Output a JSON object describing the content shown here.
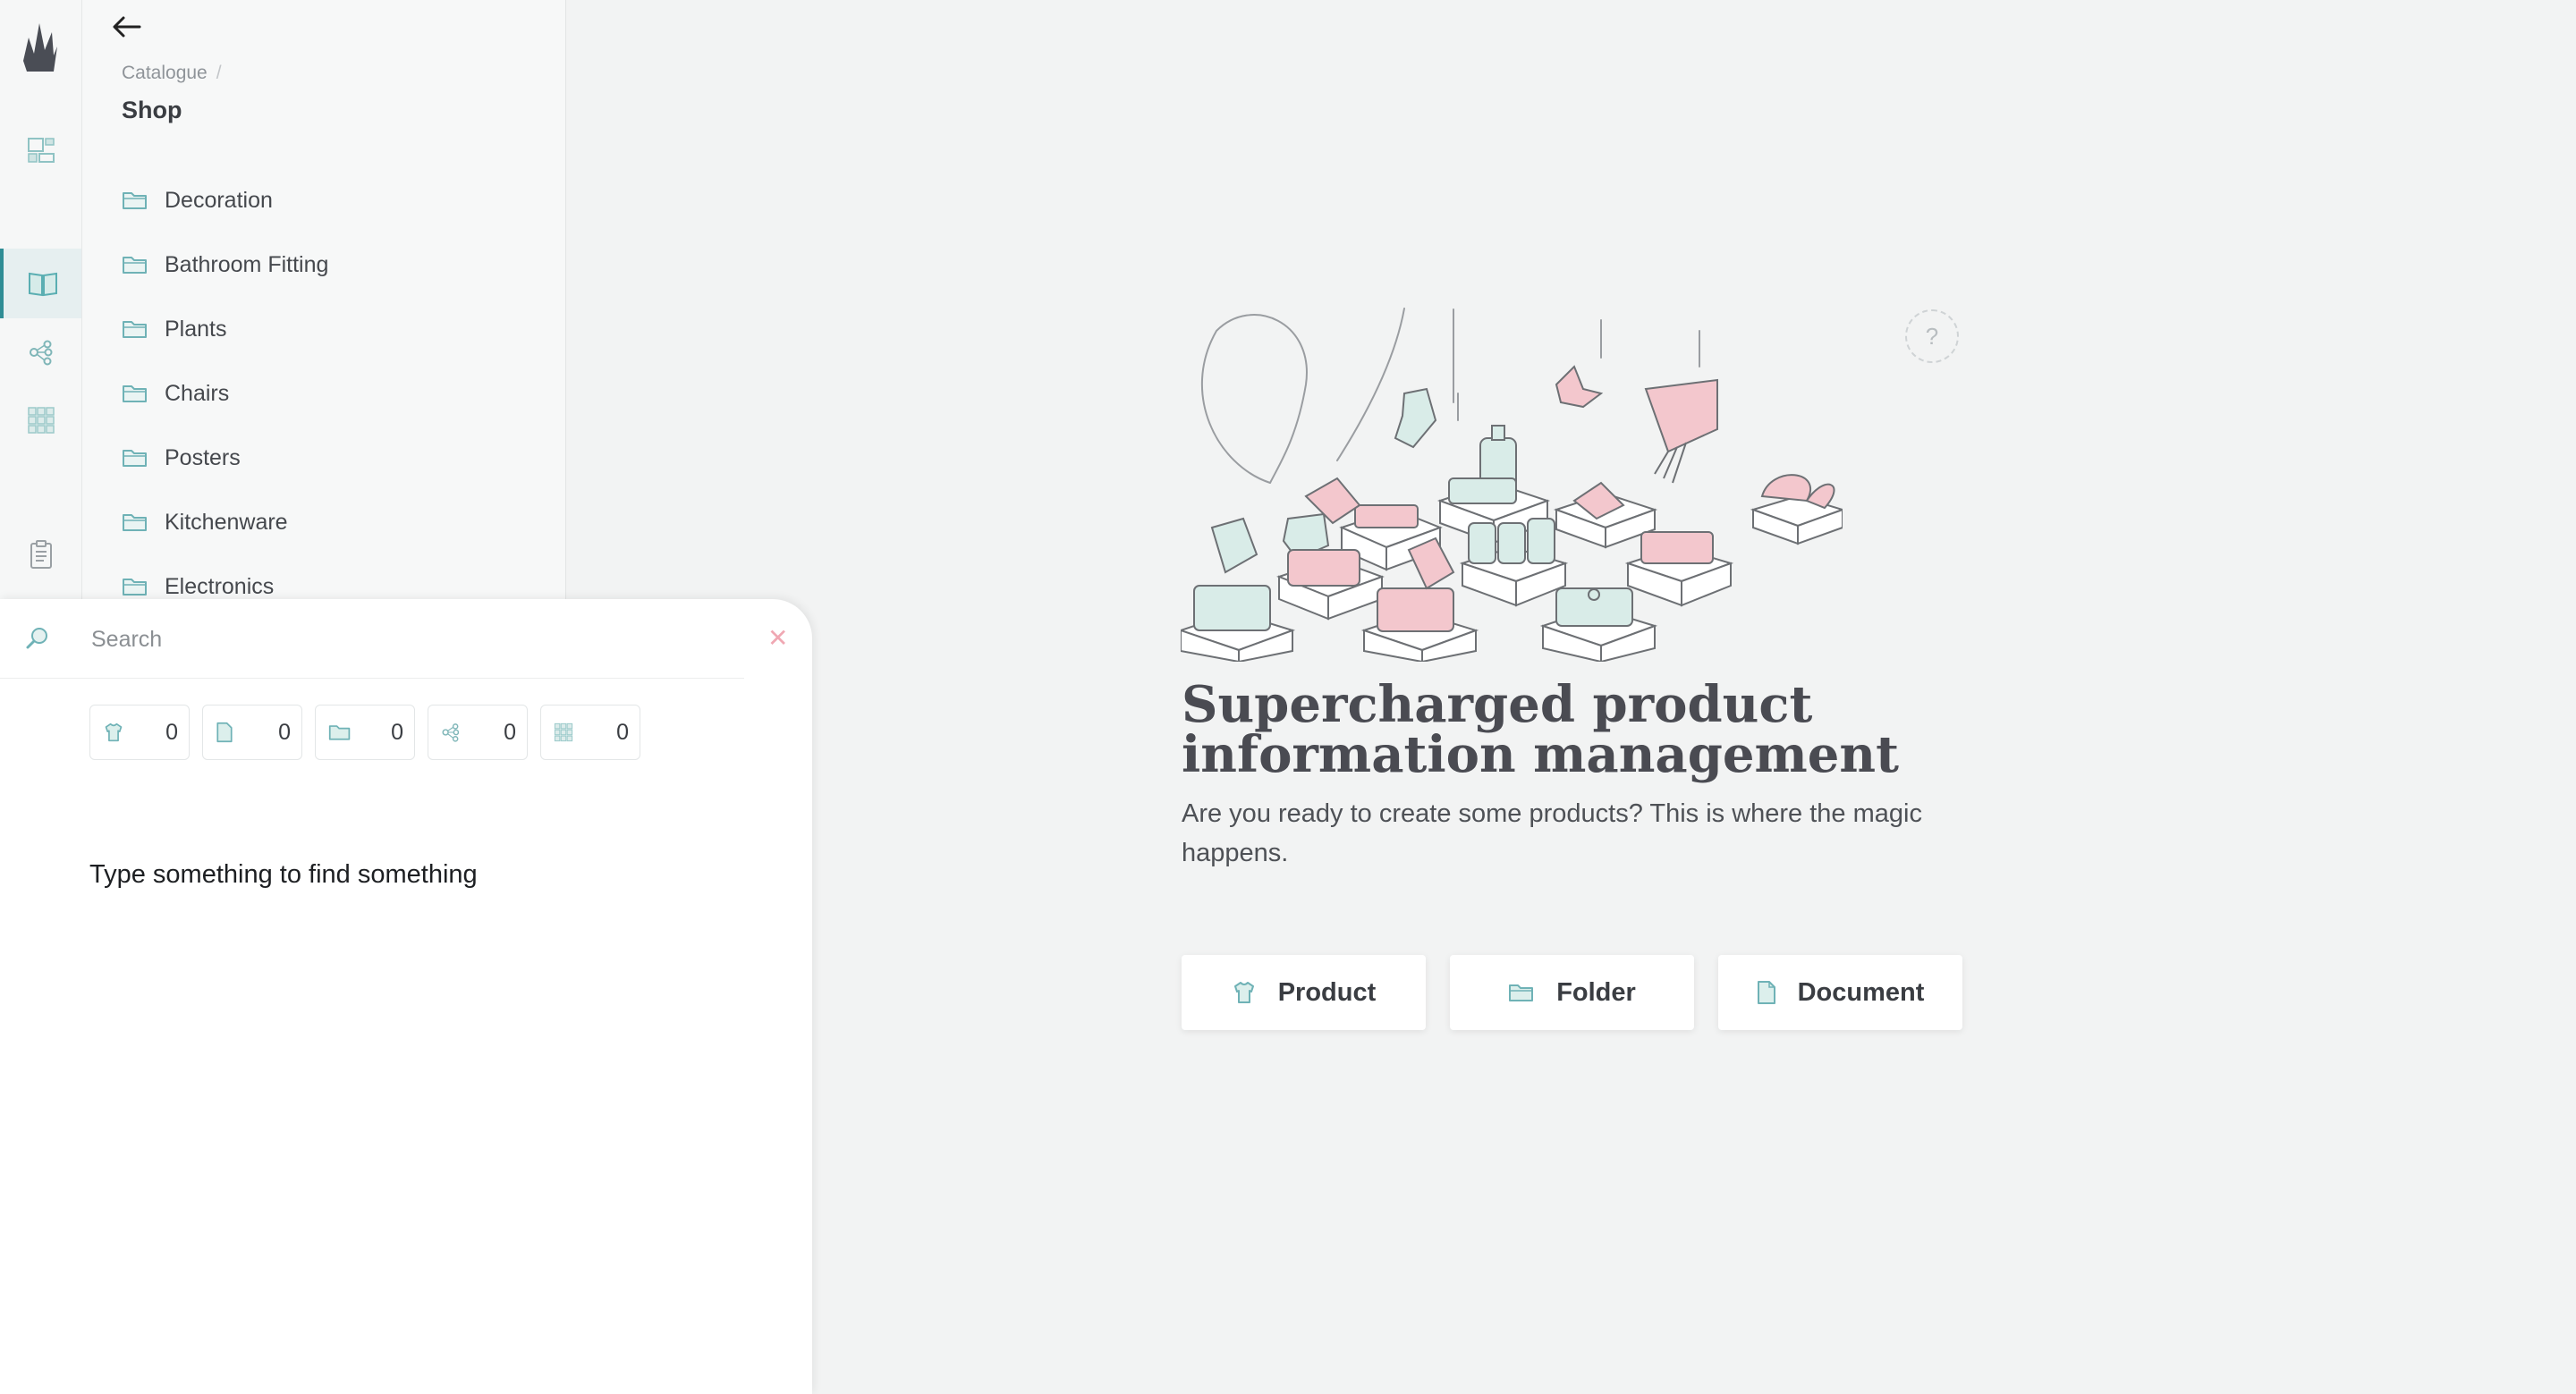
{
  "rail": {
    "items": [
      {
        "icon": "dashboard-icon"
      },
      {
        "icon": "catalogue-book-icon",
        "active": true
      },
      {
        "icon": "relations-graph-icon"
      },
      {
        "icon": "grid-icon"
      },
      {
        "icon": "clipboard-icon"
      }
    ]
  },
  "tree": {
    "breadcrumb": "Catalogue",
    "breadcrumb_separator": "/",
    "title": "Shop",
    "folders": [
      "Decoration",
      "Bathroom Fitting",
      "Plants",
      "Chairs",
      "Posters",
      "Kitchenware",
      "Electronics"
    ]
  },
  "search": {
    "placeholder": "Search",
    "value": "",
    "close_icon": "close-icon",
    "counters": [
      {
        "icon": "product-icon",
        "count": "0"
      },
      {
        "icon": "document-icon",
        "count": "0"
      },
      {
        "icon": "folder-icon",
        "count": "0"
      },
      {
        "icon": "relations-icon",
        "count": "0"
      },
      {
        "icon": "grid-icon",
        "count": "0"
      }
    ],
    "empty_message": "Type something to find something"
  },
  "main": {
    "help_label": "?",
    "headline": "Supercharged product information management",
    "subtext": "Are you ready to create some products? This is where the magic happens.",
    "actions": [
      {
        "icon": "product-icon",
        "label": "Product"
      },
      {
        "icon": "folder-icon",
        "label": "Folder"
      },
      {
        "icon": "document-icon",
        "label": "Document"
      }
    ]
  },
  "colors": {
    "accent": "#2f8d95",
    "mint": "#d9ece8",
    "pink": "#f3c7cd",
    "close": "#f0a8b3"
  }
}
